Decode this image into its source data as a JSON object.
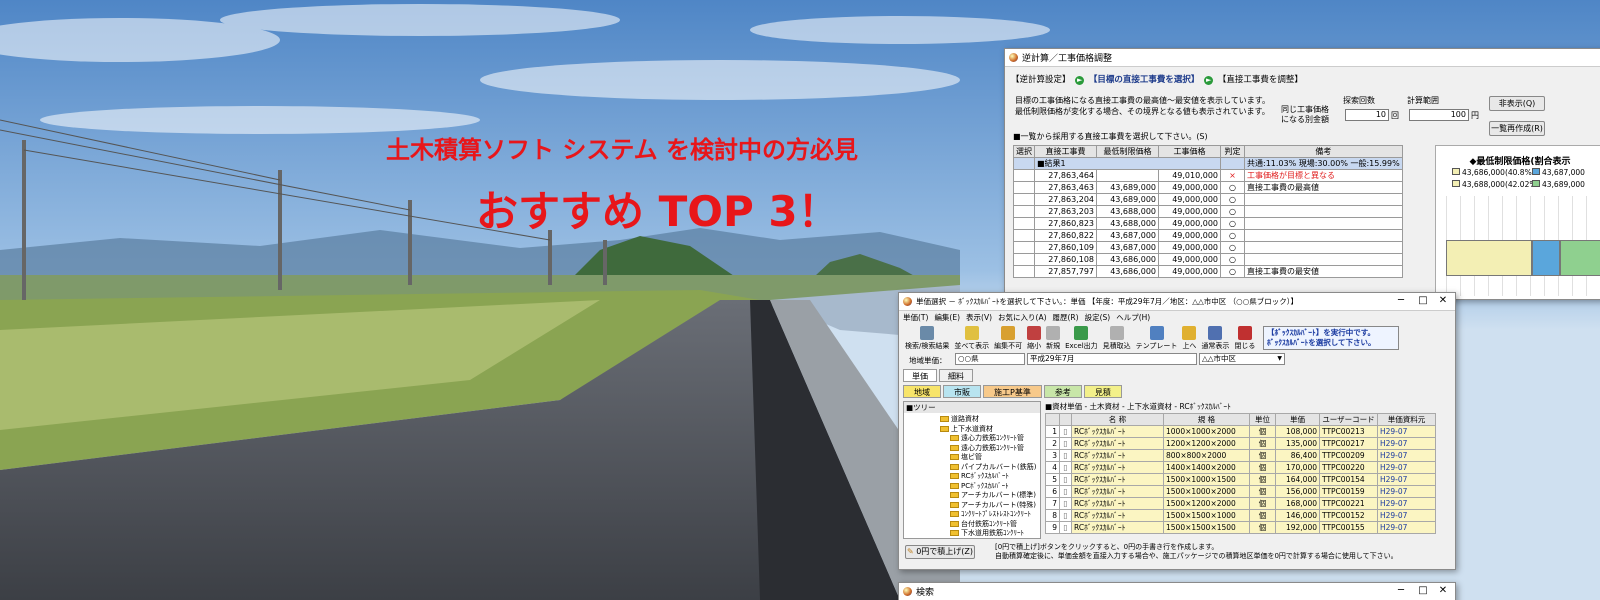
{
  "banner": {
    "headline": "土木積算ソフト システム を検討中の方必見",
    "subheadline": "おすすめ TOP 3！"
  },
  "colors": {
    "accent_red": "#e8161a",
    "sky": "#6f9dd0",
    "row_yellow": "#fbf5c2",
    "result_row": "#c8d8f0"
  },
  "win1": {
    "title": "逆計算／工事価格調整",
    "steps": [
      "【逆計算設定】",
      "【目標の直接工事費を選択】",
      "【直接工事費を調整】"
    ],
    "desc1": "目標の工事価格になる直接工事費の最高値～最安値を表示しています。",
    "desc2": "最低制限価格が変化する場合、その境界となる値も表示されています。",
    "same_price_label1": "同じ工事価格",
    "same_price_label2": "になる別金額",
    "search_count_label": "探索回数",
    "search_count_value": "10",
    "search_count_unit": "回",
    "range_label": "計算範囲",
    "range_value": "100",
    "range_unit": "円",
    "hide_button": "非表示(Q)",
    "rebuild_button": "一覧再作成(R)",
    "list_caption": "■一覧から採用する直接工事費を選択して下さい。(S)",
    "columns": [
      "選択",
      "直接工事費",
      "最低制限価格",
      "工事価格",
      "判定",
      "備考"
    ],
    "result_row": {
      "label": "■結果1",
      "note": "共通:11.03% 現場:30.00% 一般:15.99%"
    },
    "rows": [
      {
        "direct": "27,863,464",
        "min": "",
        "price": "49,010,000",
        "mark": "×",
        "note": "工事価格が目標と異なる"
      },
      {
        "direct": "27,863,463",
        "min": "43,689,000",
        "price": "49,000,000",
        "mark": "○",
        "note": "直接工事費の最高値"
      },
      {
        "direct": "27,863,204",
        "min": "43,689,000",
        "price": "49,000,000",
        "mark": "○",
        "note": ""
      },
      {
        "direct": "27,863,203",
        "min": "43,688,000",
        "price": "49,000,000",
        "mark": "○",
        "note": ""
      },
      {
        "direct": "27,860,823",
        "min": "43,688,000",
        "price": "49,000,000",
        "mark": "○",
        "note": ""
      },
      {
        "direct": "27,860,822",
        "min": "43,687,000",
        "price": "49,000,000",
        "mark": "○",
        "note": ""
      },
      {
        "direct": "27,860,109",
        "min": "43,687,000",
        "price": "49,000,000",
        "mark": "○",
        "note": ""
      },
      {
        "direct": "27,860,108",
        "min": "43,686,000",
        "price": "49,000,000",
        "mark": "○",
        "note": ""
      },
      {
        "direct": "27,857,797",
        "min": "43,686,000",
        "price": "49,000,000",
        "mark": "○",
        "note": "直接工事費の最安値"
      }
    ],
    "chart_title": "◆最低制限価格(割合表示",
    "legend": [
      {
        "text": "43,686,000(40.8%)",
        "color": "#f3efb4"
      },
      {
        "text": "43,687,000",
        "color": "#5aa6dc"
      },
      {
        "text": "43,688,000(42.02%)",
        "color": "#f3efb4"
      },
      {
        "text": "43,689,000",
        "color": "#8fd08f"
      }
    ]
  },
  "win2": {
    "title": "単価選択 － ﾎﾞｯｸｽｶﾙﾊﾞｰﾄを選択して下さい。：単価 【年度：平成29年7月／地区：△△市中区 （○○県ブロック）】",
    "menu": [
      "単価(T)",
      "編集(E)",
      "表示(V)",
      "お気に入り(A)",
      "履歴(R)",
      "設定(S)",
      "ヘルプ(H)"
    ],
    "tools": [
      {
        "label": "検索/検索結果",
        "color": "#6a8aa8"
      },
      {
        "label": "並べて表示",
        "color": "#e0c040"
      },
      {
        "label": "編集不可",
        "color": "#d8a030"
      },
      {
        "label": "縮小",
        "color": "#c04040"
      },
      {
        "label": "新規",
        "color": "#b0b0b0"
      },
      {
        "label": "Excel出力",
        "color": "#3a9a4a"
      },
      {
        "label": "見積取込",
        "color": "#b0b0b0"
      },
      {
        "label": "テンプレート",
        "color": "#5080c0"
      },
      {
        "label": "上へ",
        "color": "#e0b030"
      },
      {
        "label": "通常表示",
        "color": "#5070b0"
      },
      {
        "label": "閉じる",
        "color": "#c03030"
      }
    ],
    "notice1": "【ﾎﾞｯｸｽｶﾙﾊﾞｰﾄ】を実行中です。",
    "notice2": "ﾎﾞｯｸｽｶﾙﾊﾞｰﾄを選択して下さい。",
    "region_label": "地域単価：",
    "region_pref": "○○県",
    "region_date": "平成29年7月",
    "region_city": "△△市中区",
    "tabs_top": [
      "単価",
      "細料"
    ],
    "tabs_second": [
      "地域",
      "市販",
      "施工P基準",
      "参考",
      "見積"
    ],
    "tree_title": "■ツリー",
    "tree": [
      "道路資材",
      "上下水道資材",
      "遠心力鉄筋ｺﾝｸﾘｰﾄ管",
      "遠心力鉄筋ｺﾝｸﾘｰﾄ管",
      "塩ビ管",
      "パイプカルバート(鉄筋)",
      "RCﾎﾞｯｸｽｶﾙﾊﾞｰﾄ",
      "PCﾎﾞｯｸｽｶﾙﾊﾞｰﾄ",
      "アーチカルバート(標準)",
      "アーチカルバート(特殊)",
      "ｺﾝｸﾘｰﾄﾌﾟﾚｽﾄﾚｽﾄｺﾝｸﾘｰﾄ",
      "台付鉄筋ｺﾝｸﾘｰﾄ管",
      "下水道用鉄筋ｺﾝｸﾘｰﾄ"
    ],
    "list_title": "■資材単価 - 土木資材 - 上下水道資材 - RCﾎﾞｯｸｽｶﾙﾊﾞｰﾄ",
    "columns": [
      "名 称",
      "規 格",
      "単位",
      "単価",
      "ユーザーコード",
      "単価資料元"
    ],
    "rows": [
      {
        "no": "1",
        "name": "RCﾎﾞｯｸｽｶﾙﾊﾞｰﾄ",
        "spec": "1000×1000×2000",
        "unit": "個",
        "price": "108,000",
        "code": "TTPC00213",
        "src": "H29-07"
      },
      {
        "no": "2",
        "name": "RCﾎﾞｯｸｽｶﾙﾊﾞｰﾄ",
        "spec": "1200×1200×2000",
        "unit": "個",
        "price": "135,000",
        "code": "TTPC00217",
        "src": "H29-07"
      },
      {
        "no": "3",
        "name": "RCﾎﾞｯｸｽｶﾙﾊﾞｰﾄ",
        "spec": "800×800×2000",
        "unit": "個",
        "price": "86,400",
        "code": "TTPC00209",
        "src": "H29-07"
      },
      {
        "no": "4",
        "name": "RCﾎﾞｯｸｽｶﾙﾊﾞｰﾄ",
        "spec": "1400×1400×2000",
        "unit": "個",
        "price": "170,000",
        "code": "TTPC00220",
        "src": "H29-07"
      },
      {
        "no": "5",
        "name": "RCﾎﾞｯｸｽｶﾙﾊﾞｰﾄ",
        "spec": "1500×1000×1500",
        "unit": "個",
        "price": "164,000",
        "code": "TTPC00154",
        "src": "H29-07"
      },
      {
        "no": "6",
        "name": "RCﾎﾞｯｸｽｶﾙﾊﾞｰﾄ",
        "spec": "1500×1000×2000",
        "unit": "個",
        "price": "156,000",
        "code": "TTPC00159",
        "src": "H29-07"
      },
      {
        "no": "7",
        "name": "RCﾎﾞｯｸｽｶﾙﾊﾞｰﾄ",
        "spec": "1500×1200×2000",
        "unit": "個",
        "price": "168,000",
        "code": "TTPC00221",
        "src": "H29-07"
      },
      {
        "no": "8",
        "name": "RCﾎﾞｯｸｽｶﾙﾊﾞｰﾄ",
        "spec": "1500×1500×1000",
        "unit": "個",
        "price": "146,000",
        "code": "TTPC00152",
        "src": "H29-07"
      },
      {
        "no": "9",
        "name": "RCﾎﾞｯｸｽｶﾙﾊﾞｰﾄ",
        "spec": "1500×1500×1500",
        "unit": "個",
        "price": "192,000",
        "code": "TTPC00155",
        "src": "H29-07"
      }
    ],
    "zero_button": "0円で積上げ(Z)",
    "footer1": "[0円で積上げ]ボタンをクリックすると、0円の手書き行を作成します。",
    "footer2": "自動積算確定後に、単価金額を直接入力する場合や、施工パッケージでの積算地区単価を0円で計算する場合に使用して下さい。"
  },
  "win3": {
    "title": "検索"
  }
}
